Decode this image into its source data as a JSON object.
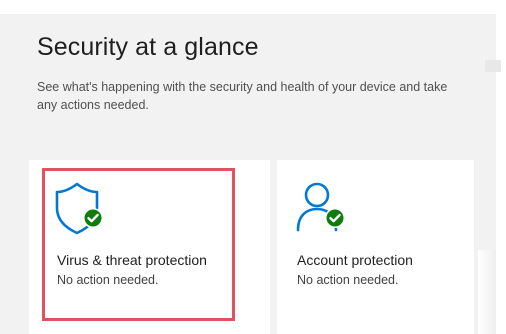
{
  "header": {
    "title": "Security at a glance",
    "subtitle": "See what's happening with the security and health of your device and take any actions needed."
  },
  "cards": [
    {
      "title": "Virus & threat protection",
      "status": "No action needed.",
      "icon": "shield-check-icon"
    },
    {
      "title": "Account protection",
      "status": "No action needed.",
      "icon": "person-check-icon"
    }
  ],
  "colors": {
    "accent": "#0078d4",
    "ok": "#107c10",
    "highlight": "#e05260",
    "background": "#f2f2f2",
    "card": "#ffffff"
  }
}
